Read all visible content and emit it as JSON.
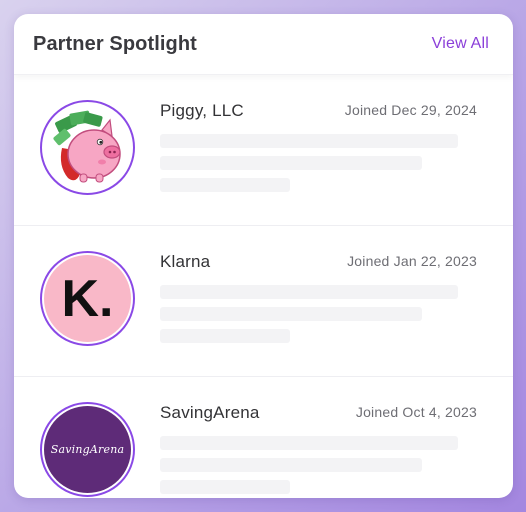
{
  "header": {
    "title": "Partner Spotlight",
    "view_all_label": "View All"
  },
  "partners": [
    {
      "name": "Piggy, LLC",
      "joined": "Joined Dec 29, 2024",
      "logo_icon": "piggy-bank-logo"
    },
    {
      "name": "Klarna",
      "joined": "Joined Jan 22, 2023",
      "logo_text": "K.",
      "logo_bg": "#f9b8c8"
    },
    {
      "name": "SavingArena",
      "joined": "Joined Oct 4, 2023",
      "logo_text": "SavingArena",
      "logo_bg": "#5e2b78"
    }
  ],
  "colors": {
    "accent": "#8b3fd9",
    "avatar_ring": "#8a49e6"
  }
}
